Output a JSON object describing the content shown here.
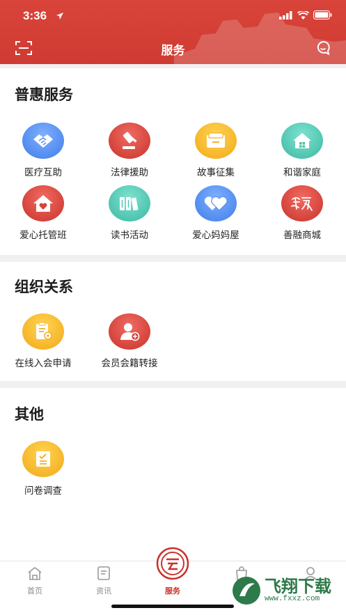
{
  "status_bar": {
    "time": "3:36"
  },
  "nav": {
    "title": "服务"
  },
  "sections": [
    {
      "title": "普惠服务",
      "items": [
        {
          "label": "医疗互助",
          "color": "blue",
          "icon": "handshake-icon"
        },
        {
          "label": "法律援助",
          "color": "red",
          "icon": "gavel-icon"
        },
        {
          "label": "故事征集",
          "color": "yellow",
          "icon": "envelope-icon"
        },
        {
          "label": "和谐家庭",
          "color": "teal",
          "icon": "house-icon"
        },
        {
          "label": "爱心托管班",
          "color": "red",
          "icon": "heart-house-icon"
        },
        {
          "label": "读书活动",
          "color": "teal",
          "icon": "books-icon"
        },
        {
          "label": "爱心妈妈屋",
          "color": "blue",
          "icon": "hearts-icon"
        },
        {
          "label": "善融商城",
          "color": "red",
          "icon": "shanrong-logo-icon"
        }
      ]
    },
    {
      "title": "组织关系",
      "items": [
        {
          "label": "在线入会申请",
          "color": "yellow",
          "icon": "clipboard-icon"
        },
        {
          "label": "会员会籍转接",
          "color": "red",
          "icon": "user-add-icon"
        }
      ]
    },
    {
      "title": "其他",
      "items": [
        {
          "label": "问卷调查",
          "color": "yellow",
          "icon": "checklist-icon"
        }
      ]
    }
  ],
  "tabs": [
    {
      "label": "首页",
      "icon": "home-icon"
    },
    {
      "label": "资讯",
      "icon": "news-icon"
    },
    {
      "label": "服务",
      "icon": "service-icon",
      "active": true
    },
    {
      "label": "",
      "icon": "bag-icon"
    },
    {
      "label": "",
      "icon": "profile-icon"
    }
  ],
  "watermark": {
    "name": "飞翔下载",
    "url": "www.fxxz.com"
  }
}
